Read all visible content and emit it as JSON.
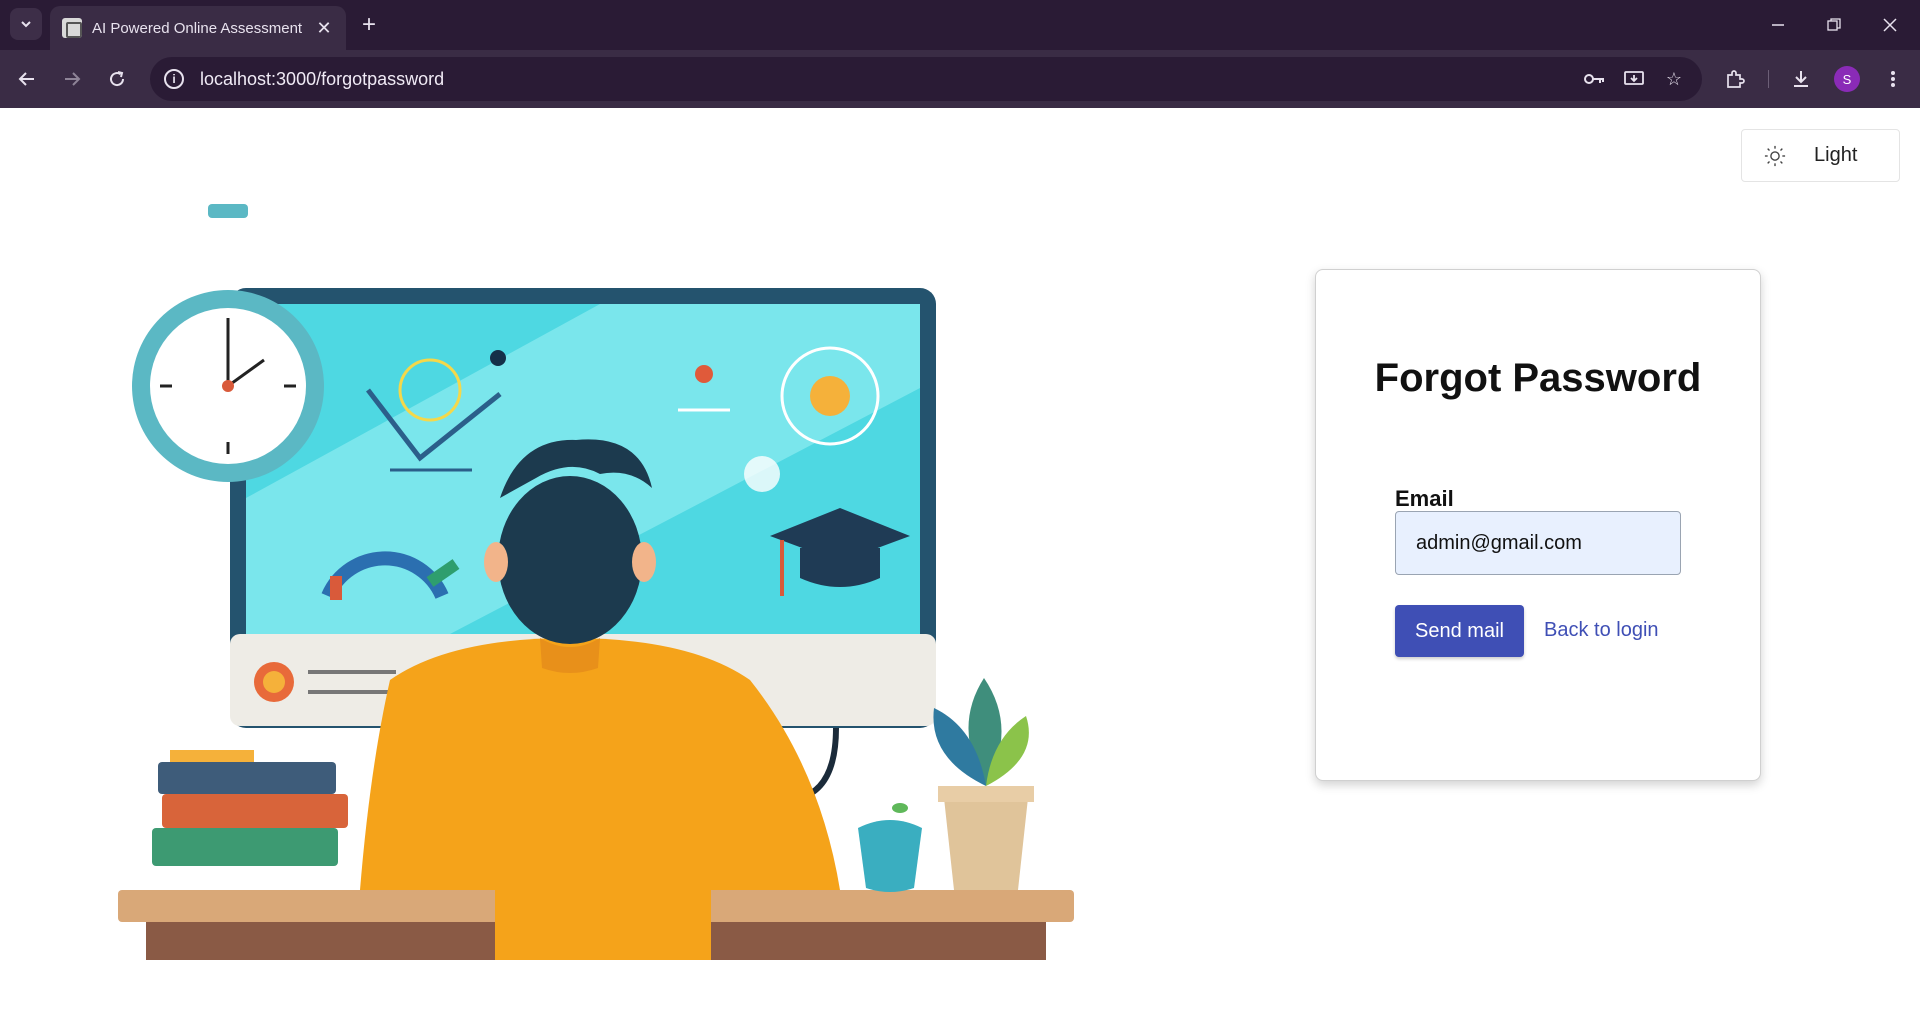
{
  "browser": {
    "tab_title": "AI Powered Online Assessment",
    "url": "localhost:3000/forgotpassword",
    "profile_initial": "S"
  },
  "theme_toggle": {
    "label": "Light",
    "icon": "sun-icon"
  },
  "form": {
    "title": "Forgot Password",
    "email_label": "Email",
    "email_value": "admin@gmail.com",
    "send_button": "Send mail",
    "back_link": "Back to login"
  },
  "colors": {
    "primary": "#3f4fb5",
    "input_bg": "#e8f0fe",
    "chrome_dark": "#2a1b35",
    "chrome_toolbar": "#3a2c45"
  }
}
